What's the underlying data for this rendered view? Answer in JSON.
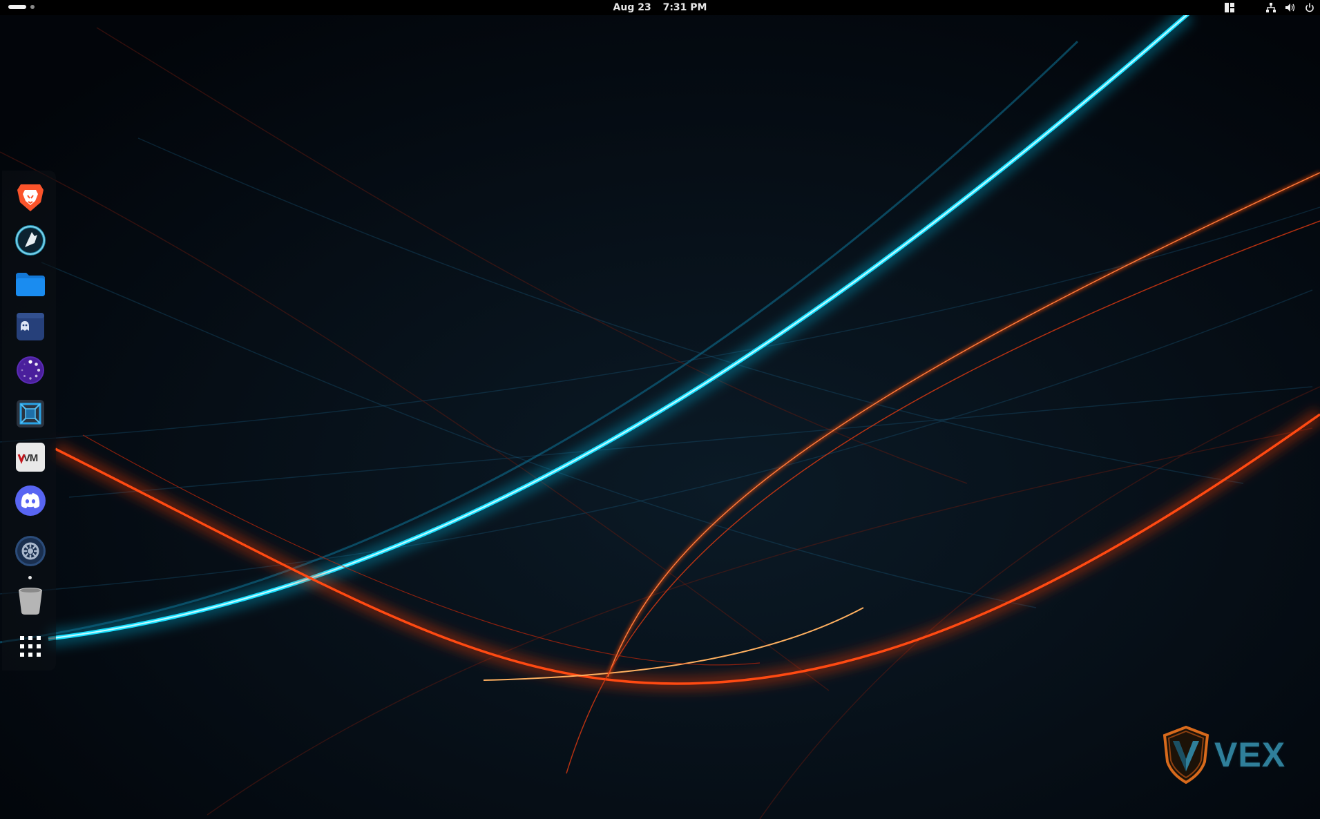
{
  "topbar": {
    "date": "Aug 23",
    "time": "7:31 PM",
    "tray_icons": [
      "window-tiling-icon",
      "network-icon",
      "volume-icon",
      "power-icon"
    ]
  },
  "dock": {
    "apps": [
      {
        "name": "brave-browser",
        "icon": "brave-lion-icon",
        "color": "#fb542b"
      },
      {
        "name": "cachy-browser",
        "icon": "wolf-compass-icon",
        "color": "#1e8fb0"
      },
      {
        "name": "files",
        "icon": "folder-icon",
        "color": "#1a8cf0"
      },
      {
        "name": "ghost-app",
        "icon": "ghost-icon",
        "color": "#26407a"
      },
      {
        "name": "loading-app",
        "icon": "spinner-icon",
        "color": "#5a2bb5"
      },
      {
        "name": "virtual-machine-manager",
        "icon": "vm-frame-icon",
        "color": "#1e6fa8"
      },
      {
        "name": "vmware",
        "icon": "vmware-icon",
        "color": "#e9e9e9"
      },
      {
        "name": "discord",
        "icon": "discord-icon",
        "color": "#5865f2"
      },
      {
        "name": "settings",
        "icon": "gear-icon",
        "color": "#2b4c7a",
        "running": true
      },
      {
        "name": "trash",
        "icon": "trash-icon",
        "color": "#b5b5b5"
      },
      {
        "name": "show-apps",
        "icon": "app-grid-icon",
        "color": "#ffffff"
      }
    ]
  },
  "brand": {
    "text": "VEX",
    "shield_color": "#d86a1c",
    "accent_color": "#2f7f9a"
  },
  "wallpaper": {
    "base_color": "#03070c",
    "streak_cyan": "#19e0ff",
    "streak_orange": "#ff4a12"
  }
}
